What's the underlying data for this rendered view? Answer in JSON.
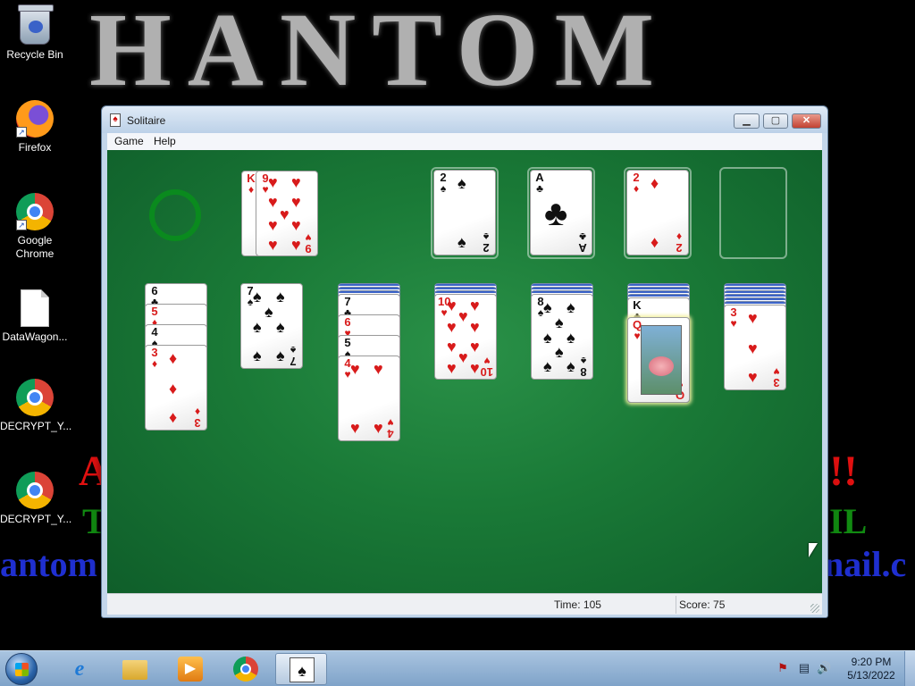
{
  "desktop": {
    "icons": [
      {
        "label": "Recycle Bin"
      },
      {
        "label": "Firefox"
      },
      {
        "label": "Google Chrome"
      },
      {
        "label": "DataWagon..."
      },
      {
        "label": "DECRYPT_Y..."
      },
      {
        "label": "DECRYPT_Y..."
      }
    ],
    "wallpaper": {
      "line1": "A",
      "line1_right": "!!",
      "line2": "T",
      "line2_right": "IL",
      "line3": "antom",
      "line3_right": "nail.c"
    }
  },
  "window": {
    "title": "Solitaire",
    "menu": {
      "game": "Game",
      "help": "Help"
    },
    "controls": {
      "minimize": "▁",
      "maximize": "▢",
      "close": "✕"
    },
    "status": {
      "time": "Time:  105",
      "score": "Score: 75"
    }
  },
  "solitaire": {
    "waste": [
      {
        "rank": "K",
        "suit": "♦",
        "color": "red"
      },
      {
        "rank": "9",
        "suit": "♥",
        "color": "red"
      }
    ],
    "foundations": [
      {
        "rank": "2",
        "suit": "♠",
        "color": "black"
      },
      {
        "rank": "A",
        "suit": "♣",
        "color": "black"
      },
      {
        "rank": "2",
        "suit": "♦",
        "color": "red"
      },
      {
        "rank": "",
        "suit": "",
        "color": "empty"
      }
    ],
    "tableau": [
      {
        "face_down": 0,
        "cards": [
          [
            "6",
            "♣",
            "black"
          ],
          [
            "5",
            "♦",
            "red"
          ],
          [
            "4",
            "♠",
            "black"
          ],
          [
            "3",
            "♦",
            "red"
          ]
        ]
      },
      {
        "face_down": 0,
        "cards": [
          [
            "7",
            "♠",
            "black"
          ]
        ]
      },
      {
        "face_down": 3,
        "cards": [
          [
            "7",
            "♣",
            "black"
          ],
          [
            "6",
            "♥",
            "red"
          ],
          [
            "5",
            "♠",
            "black"
          ],
          [
            "4",
            "♥",
            "red"
          ]
        ]
      },
      {
        "face_down": 3,
        "cards": [
          [
            "10",
            "♥",
            "red"
          ]
        ]
      },
      {
        "face_down": 3,
        "cards": [
          [
            "8",
            "♠",
            "black"
          ]
        ]
      },
      {
        "face_down": 4,
        "cards": [
          [
            "K",
            "♣",
            "black"
          ],
          [
            "Q",
            "♥",
            "red"
          ]
        ]
      },
      {
        "face_down": 6,
        "cards": [
          [
            "3",
            "♥",
            "red"
          ]
        ]
      }
    ]
  },
  "taskbar": {
    "apps": [
      {
        "name": "ie",
        "glyph": "e"
      },
      {
        "name": "explorer",
        "glyph": ""
      },
      {
        "name": "media",
        "glyph": "▶"
      },
      {
        "name": "chrome",
        "glyph": ""
      },
      {
        "name": "solitaire",
        "glyph": "♠"
      }
    ],
    "tray": {
      "flag": "⚑",
      "network": "▤",
      "volume": "🔊"
    },
    "clock": {
      "time": "9:20 PM",
      "date": "5/13/2022"
    }
  },
  "colors": {
    "felt": "#1a7a37",
    "red_suit": "#d81b1b",
    "titlebar": "#bcd1e8"
  }
}
